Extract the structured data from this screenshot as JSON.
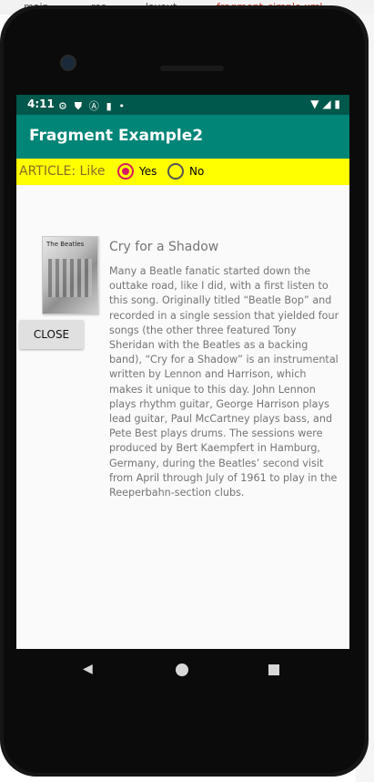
{
  "ide": {
    "breadcrumbs": [
      "main",
      "res",
      "layout",
      "fragment_simple.xml"
    ]
  },
  "status_bar": {
    "time": "4:11",
    "icons": [
      "gear-icon",
      "shield-icon",
      "a-icon",
      "sd-card-icon",
      "dot-icon"
    ],
    "right_icons": [
      "wifi-icon",
      "signal-icon",
      "battery-icon"
    ]
  },
  "app_bar": {
    "title": "Fragment Example2"
  },
  "article_bar": {
    "label": "ARTICLE: Like",
    "options": [
      {
        "label": "Yes",
        "checked": true
      },
      {
        "label": "No",
        "checked": false
      }
    ]
  },
  "content": {
    "close_label": "CLOSE",
    "heading": "Cry for a Shadow",
    "body": "Many a Beatle fanatic started down the outtake road, like I did, with a first listen to this song. Originally titled “Beatle Bop” and recorded in a single session that yielded four songs (the other three featured Tony Sheridan with the Beatles as a backing band), “Cry for a Shadow” is an instrumental written by Lennon and Harrison, which makes it unique to this day. John Lennon plays rhythm guitar, George Harrison plays lead guitar, Paul McCartney plays bass, and Pete Best plays drums. The sessions were produced by Bert Kaempfert in Hamburg, Germany, during the Beatles’ second visit from April through July of 1961 to play in the Reeperbahn-section clubs.",
    "album_text": "The Beatles"
  },
  "colors": {
    "status_bar": "#00574b",
    "app_bar": "#008577",
    "article_bar": "#ffff00",
    "accent": "#d81b60"
  }
}
